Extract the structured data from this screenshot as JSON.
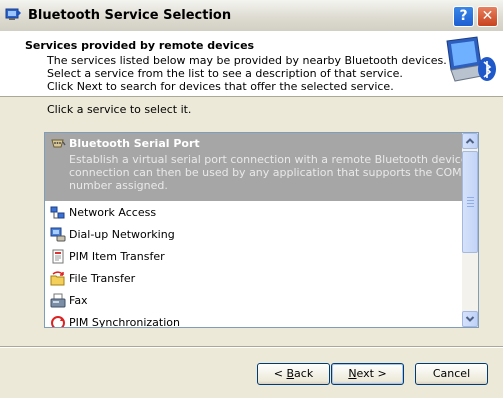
{
  "window": {
    "title": "Bluetooth Service Selection",
    "help_label": "?",
    "close_label": "✕"
  },
  "header": {
    "title": "Services provided by remote devices",
    "desc_lines": [
      "The services listed below may be provided by nearby Bluetooth devices.",
      "Select a service from the list to see a description of that service.",
      "Click Next to search for devices that offer the selected service."
    ]
  },
  "instruction": "Click a service to select it.",
  "services": {
    "selected": {
      "name": "Bluetooth Serial Port",
      "desc_lines": [
        "Establish a virtual serial port connection with a remote Bluetooth device. The",
        "connection can then be used by any application that supports the COM port",
        "number assigned."
      ]
    },
    "items": [
      {
        "name": "Network Access",
        "icon": "network-access-icon"
      },
      {
        "name": "Dial-up Networking",
        "icon": "dialup-networking-icon"
      },
      {
        "name": "PIM Item Transfer",
        "icon": "pim-item-transfer-icon"
      },
      {
        "name": "File Transfer",
        "icon": "file-transfer-icon"
      },
      {
        "name": "Fax",
        "icon": "fax-icon"
      },
      {
        "name": "PIM Synchronization",
        "icon": "pim-synchronization-icon"
      }
    ]
  },
  "buttons": {
    "back_pre": "< ",
    "back_key": "B",
    "back_post": "ack",
    "next_key": "N",
    "next_post": "ext >",
    "cancel": "Cancel"
  }
}
